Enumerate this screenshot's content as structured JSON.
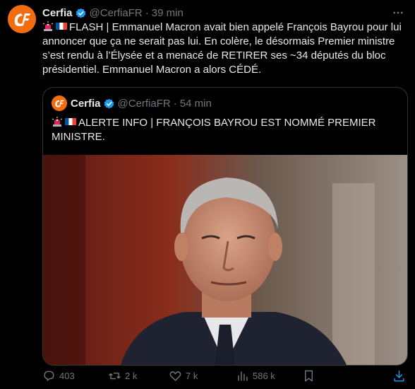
{
  "tweet": {
    "name": "Cerfia",
    "handle": "@CerfiaFR",
    "dot": "·",
    "time": "39 min",
    "text": "FLASH | Emmanuel Macron avait bien appelé François Bayrou pour lui annoncer que ça ne serait pas lui. En colère, le désormais Premier ministre s’est rendu à l’Élysée et a menacé de RETIRER ses ~34 députés du bloc présidentiel. Emmanuel Macron a alors CÉDÉ."
  },
  "quote": {
    "name": "Cerfia",
    "handle": "@CerfiaFR",
    "dot": "·",
    "time": "54 min",
    "text": "ALERTE INFO | FRANÇOIS BAYROU EST NOMMÉ PREMIER MINISTRE."
  },
  "actions": {
    "replies": "403",
    "reposts": "2 k",
    "likes": "7 k",
    "views": "586 k"
  },
  "colors": {
    "brand": "#f26d0f",
    "verified": "#1d9bf0",
    "muted": "#71767b",
    "border": "#2f3336"
  },
  "icons": [
    "cf-logo-icon",
    "verified-badge-icon",
    "more-icon",
    "police-light-icon",
    "france-flag-icon",
    "reply-icon",
    "repost-icon",
    "like-icon",
    "views-icon",
    "bookmark-icon",
    "share-icon"
  ]
}
